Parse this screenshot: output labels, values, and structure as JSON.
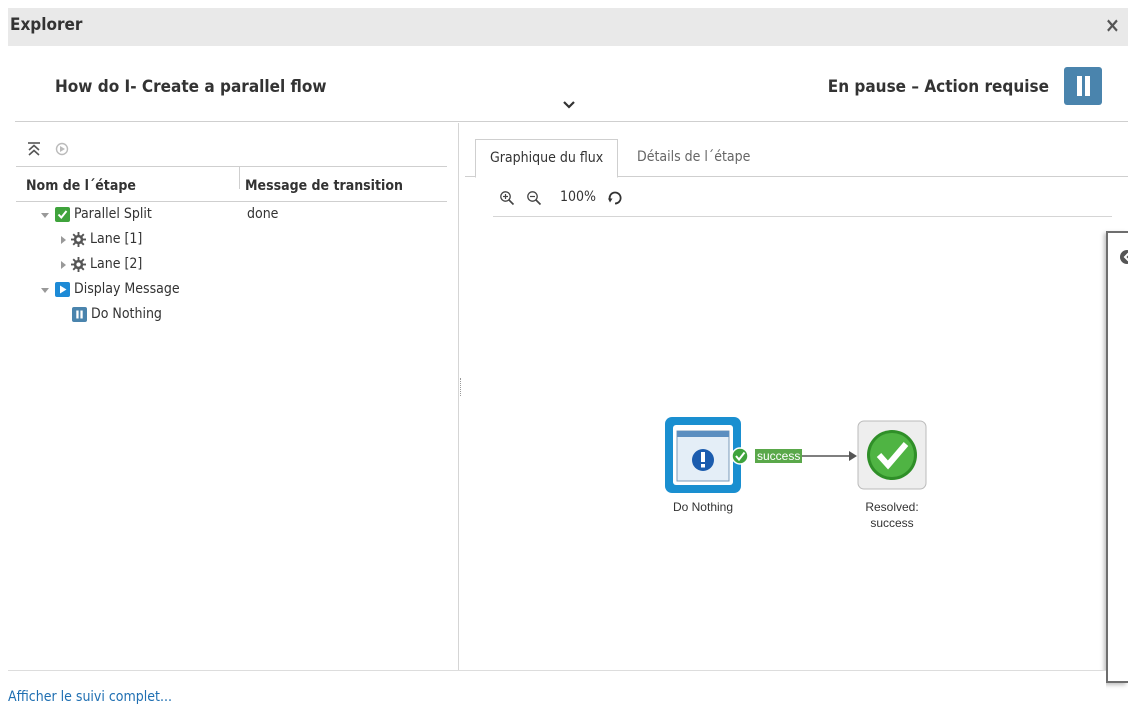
{
  "window": {
    "title": "Explorer",
    "close_label": "×"
  },
  "header": {
    "flow_name": "How do I- Create a parallel flow",
    "status": "En pause – Action requise",
    "pause_color": "#4a84ad"
  },
  "tree": {
    "columns": [
      "Nom de l´étape",
      "Message de transition"
    ],
    "rows": [
      {
        "label": "Parallel Split",
        "message": "done",
        "icon": "check-icon"
      },
      {
        "label": "Lane [1]",
        "message": "",
        "icon": "gear-icon"
      },
      {
        "label": "Lane [2]",
        "message": "",
        "icon": "gear-icon"
      },
      {
        "label": "Display Message",
        "message": "",
        "icon": "play-icon"
      },
      {
        "label": "Do Nothing",
        "message": "",
        "icon": "pause-icon"
      }
    ]
  },
  "tabs": [
    {
      "label": "Graphique du flux",
      "active": true
    },
    {
      "label": "Détails de l´étape",
      "active": false
    }
  ],
  "zoom": {
    "level": "100%"
  },
  "graph": {
    "nodes": [
      {
        "label": "Do Nothing"
      },
      {
        "label_line1": "Resolved:",
        "label_line2": "success"
      }
    ],
    "transition": "success"
  },
  "footer": {
    "link": "Afficher le suivi complet..."
  },
  "colors": {
    "accent": "#4a84ad",
    "link": "#1f6fb2",
    "success": "#5aa84a",
    "selected_node": "#1a8fd0"
  }
}
